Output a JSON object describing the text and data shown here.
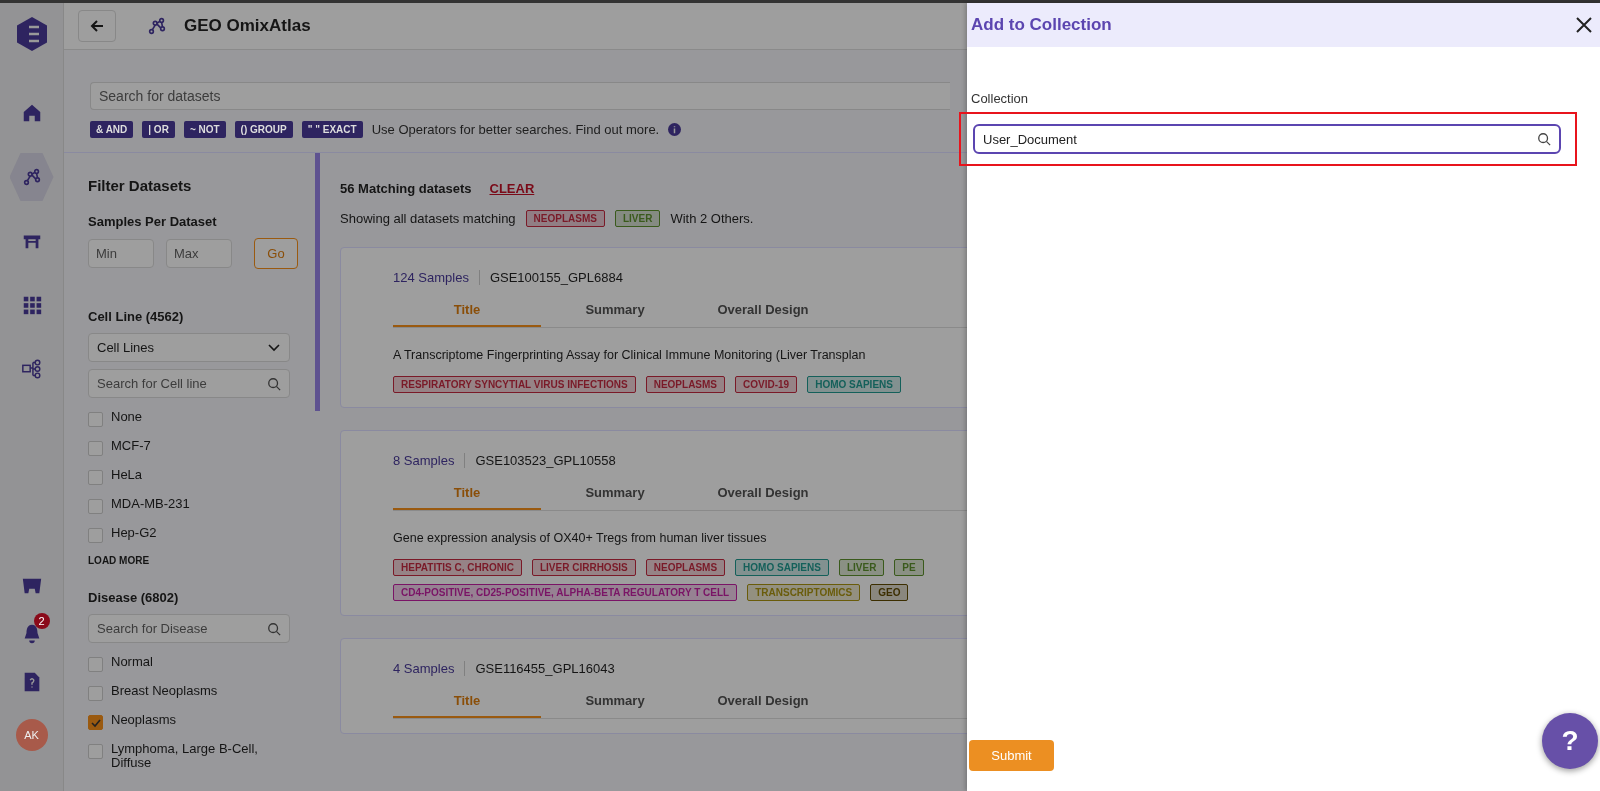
{
  "nav": {
    "items": [
      {
        "selected": false
      },
      {
        "selected": true
      },
      {
        "selected": false
      },
      {
        "selected": false
      },
      {
        "selected": false
      }
    ],
    "notifications": "2",
    "avatar": "AK"
  },
  "header": {
    "title": "GEO OmixAtlas"
  },
  "search": {
    "placeholder": "Search for datasets"
  },
  "operators": [
    "& AND",
    "| OR",
    "~ NOT",
    "() GROUP",
    "\" \" EXACT"
  ],
  "operators_hint": "Use Operators for better searches. Find out more.",
  "filters": {
    "title": "Filter Datasets",
    "samples": {
      "label": "Samples Per Dataset",
      "min_placeholder": "Min",
      "max_placeholder": "Max",
      "go": "Go"
    },
    "cell_line": {
      "label": "Cell Line (4562)",
      "dropdown": "Cell Lines",
      "search_placeholder": "Search for Cell line",
      "options": [
        {
          "label": "None",
          "checked": false
        },
        {
          "label": "MCF-7",
          "checked": false
        },
        {
          "label": "HeLa",
          "checked": false
        },
        {
          "label": "MDA-MB-231",
          "checked": false
        },
        {
          "label": "Hep-G2",
          "checked": false
        }
      ],
      "load_more": "LOAD MORE"
    },
    "disease": {
      "label": "Disease (6802)",
      "search_placeholder": "Search for Disease",
      "options": [
        {
          "label": "Normal",
          "checked": false
        },
        {
          "label": "Breast Neoplasms",
          "checked": false
        },
        {
          "label": "Neoplasms",
          "checked": true
        },
        {
          "label": "Lymphoma, Large B-Cell, Diffuse",
          "checked": false
        }
      ]
    }
  },
  "results": {
    "count": "56 Matching datasets",
    "clear": "CLEAR",
    "showing": "Showing all datasets matching",
    "tags": [
      {
        "label": "NEOPLASMS",
        "color": "#7a1a28"
      },
      {
        "label": "LIVER",
        "color": "#3a5a1c"
      }
    ],
    "others": "With 2 Others."
  },
  "datasets": [
    {
      "samples": "124 Samples",
      "id": "GSE100155_GPL6884",
      "tabs": [
        {
          "label": "Title",
          "selected": true
        },
        {
          "label": "Summary",
          "selected": false
        },
        {
          "label": "Overall Design",
          "selected": false
        }
      ],
      "title": "A Transcriptome Fingerprinting Assay for Clinical Immune Monitoring (Liver Transplan",
      "tags": [
        {
          "label": "RESPIRATORY SYNCYTIAL VIRUS INFECTIONS",
          "color": "#7a1a28"
        },
        {
          "label": "NEOPLASMS",
          "color": "#7a1a28"
        },
        {
          "label": "COVID-19",
          "color": "#7a1a28"
        },
        {
          "label": "HOMO SAPIENS",
          "color": "#14605a"
        }
      ]
    },
    {
      "samples": "8 Samples",
      "id": "GSE103523_GPL10558",
      "tabs": [
        {
          "label": "Title",
          "selected": true
        },
        {
          "label": "Summary",
          "selected": false
        },
        {
          "label": "Overall Design",
          "selected": false
        }
      ],
      "title": "Gene expression analysis of OX40+ Tregs from human liver tissues",
      "tags": [
        {
          "label": "HEPATITIS C, CHRONIC",
          "color": "#7a1a28"
        },
        {
          "label": "LIVER CIRRHOSIS",
          "color": "#7a1a28"
        },
        {
          "label": "NEOPLASMS",
          "color": "#7a1a28"
        },
        {
          "label": "HOMO SAPIENS",
          "color": "#14605a"
        },
        {
          "label": "LIVER",
          "color": "#3a5a1c"
        },
        {
          "label": "PE",
          "color": "#3a5a1c"
        },
        {
          "label": "CD4-POSITIVE, CD25-POSITIVE, ALPHA-BETA REGULATORY T CELL",
          "color": "#7a1466"
        },
        {
          "label": "TRANSCRIPTOMICS",
          "color": "#6a5c0a"
        },
        {
          "label": "GEO",
          "color": "#3c2e00"
        }
      ]
    },
    {
      "samples": "4 Samples",
      "id": "GSE116455_GPL16043",
      "tabs": [
        {
          "label": "Title",
          "selected": true
        },
        {
          "label": "Summary",
          "selected": false
        },
        {
          "label": "Overall Design",
          "selected": false
        }
      ]
    }
  ],
  "drawer": {
    "title": "Add to Collection",
    "field_label": "Collection",
    "value": "User_Document",
    "highlighted": true,
    "submit": "Submit"
  },
  "help_button": "?"
}
